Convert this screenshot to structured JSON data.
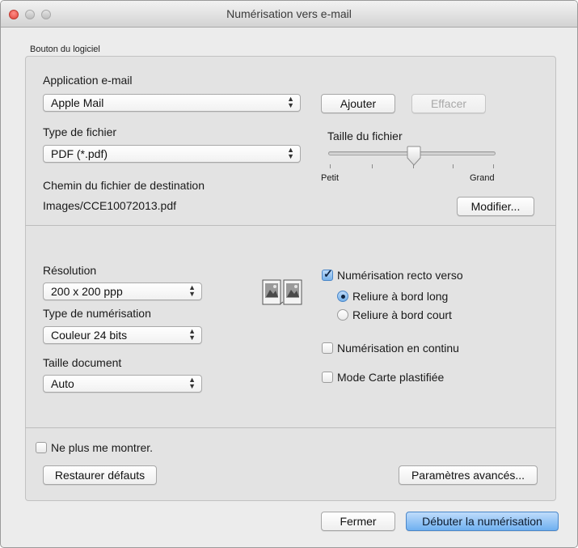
{
  "window": {
    "title": "Numérisation vers e-mail"
  },
  "group_title": "Bouton du logiciel",
  "email_app": {
    "label": "Application e-mail",
    "value": "Apple Mail",
    "add_label": "Ajouter",
    "clear_label": "Effacer"
  },
  "file_type": {
    "label": "Type de fichier",
    "value": "PDF (*.pdf)"
  },
  "file_size": {
    "label": "Taille du fichier",
    "min_label": "Petit",
    "max_label": "Grand",
    "level_fraction": 0.5
  },
  "destination": {
    "label": "Chemin du fichier de destination",
    "path": "Images/CCE10072013.pdf",
    "modify_label": "Modifier..."
  },
  "resolution": {
    "label": "Résolution",
    "value": "200 x 200 ppp"
  },
  "scan_type": {
    "label": "Type de numérisation",
    "value": "Couleur 24 bits"
  },
  "doc_size": {
    "label": "Taille document",
    "value": "Auto"
  },
  "duplex": {
    "label": "Numérisation recto verso",
    "checked": true,
    "options": [
      {
        "label": "Reliure à bord long",
        "selected": true
      },
      {
        "label": "Reliure à bord court",
        "selected": false
      }
    ]
  },
  "continuous": {
    "label": "Numérisation en continu",
    "checked": false
  },
  "card_mode": {
    "label": "Mode Carte plastifiée",
    "checked": false
  },
  "dont_show": {
    "label": "Ne plus me montrer.",
    "checked": false
  },
  "buttons": {
    "restore": "Restaurer défauts",
    "advanced": "Paramètres avancés...",
    "close": "Fermer",
    "start": "Débuter la numérisation"
  },
  "colors": {
    "accent": "#6fb0f0",
    "close_button": "#e0443b"
  }
}
